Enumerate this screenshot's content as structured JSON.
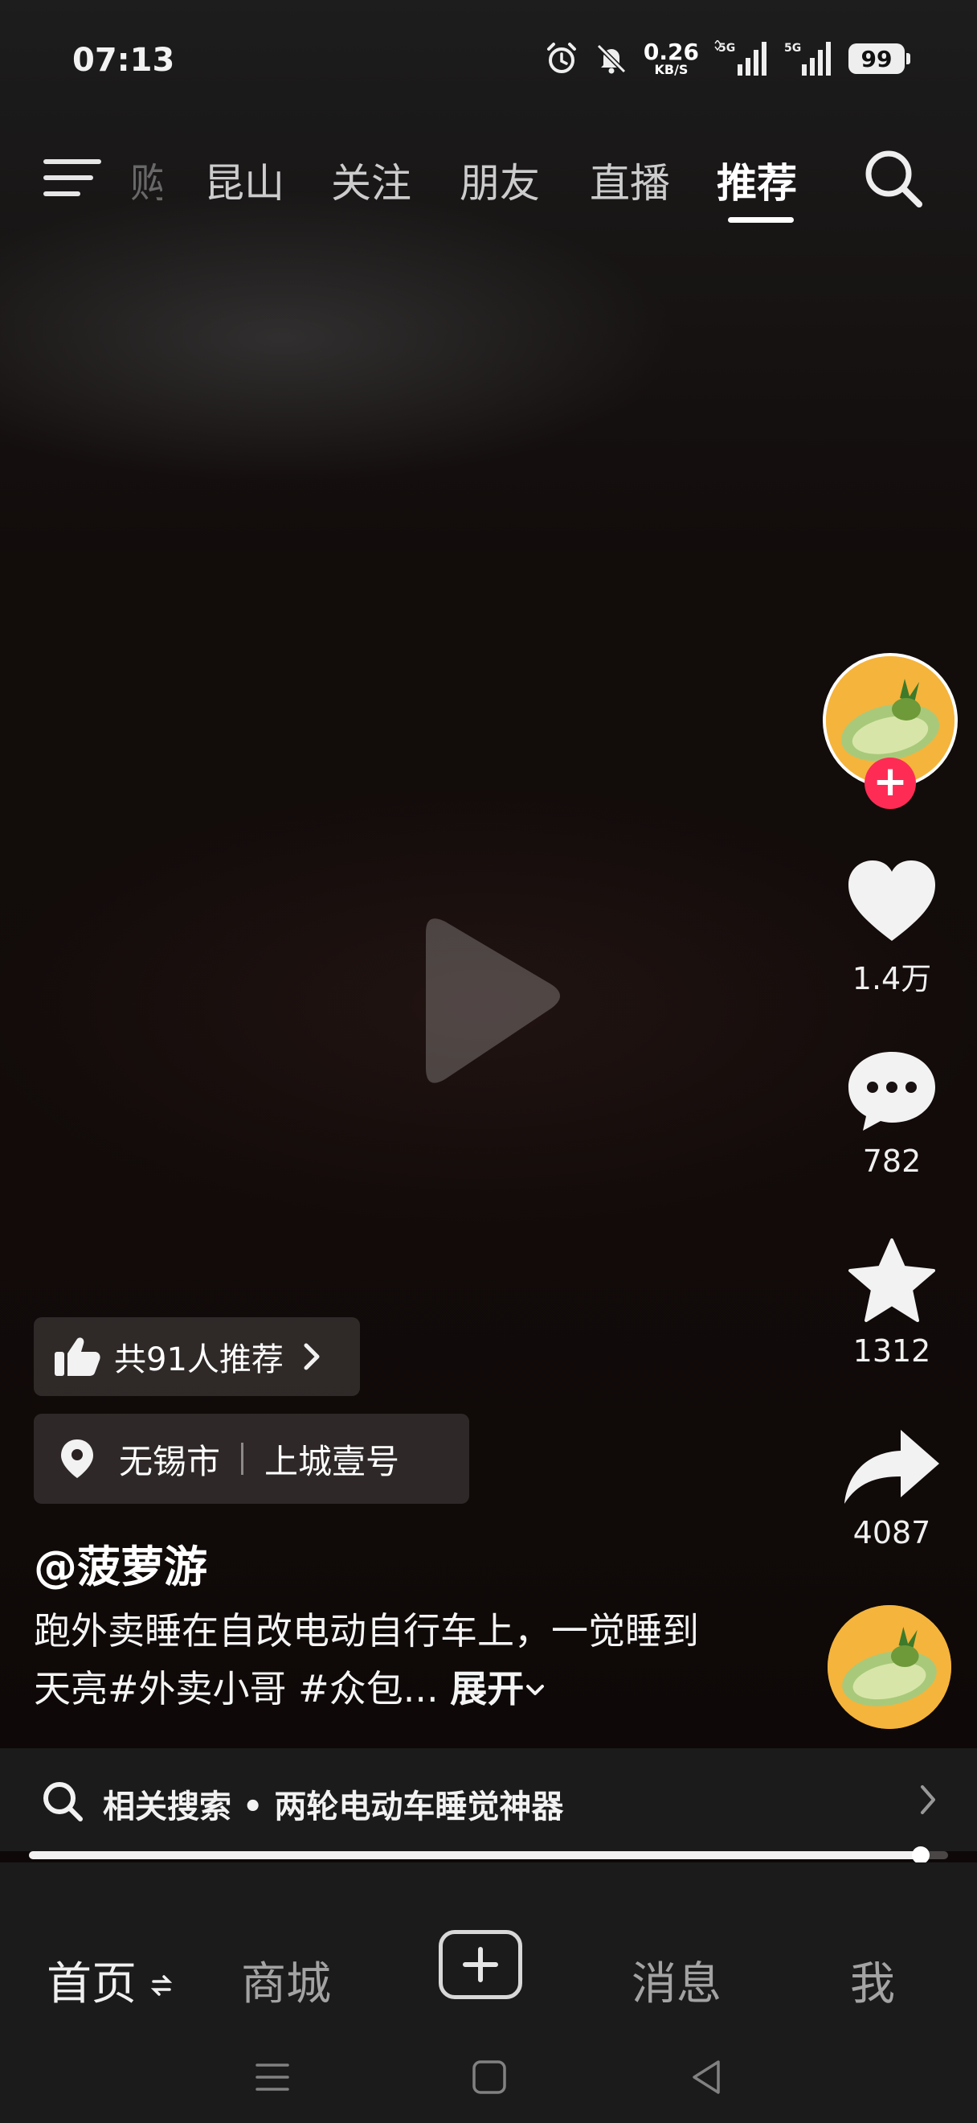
{
  "status_bar": {
    "time": "07:13",
    "net_speed_value": "0.26",
    "net_speed_unit": "KB/S",
    "network_1": "5G",
    "network_2": "5G",
    "battery": "99"
  },
  "top_nav": {
    "tabs": [
      {
        "label": "购"
      },
      {
        "label": "昆山"
      },
      {
        "label": "关注"
      },
      {
        "label": "朋友"
      },
      {
        "label": "直播"
      },
      {
        "label": "推荐"
      }
    ],
    "active_tab": "推荐"
  },
  "video": {
    "state": "paused",
    "recommend_label": "共91人推荐",
    "location_city": "无锡市",
    "location_place": "上城壹号",
    "author": "@菠萝游",
    "description": "跑外卖睡在自改电动自行车上，一觉睡到天亮#外卖小哥 #众包...",
    "expand_label": "展开",
    "progress": 0.97
  },
  "actions": {
    "likes": "1.4万",
    "comments": "782",
    "favorites": "1312",
    "shares": "4087"
  },
  "related_search": {
    "label": "相关搜索 • 两轮电动车睡觉神器"
  },
  "bottom_nav": {
    "items": [
      {
        "label": "首页"
      },
      {
        "label": "商城"
      },
      {
        "label": "消息"
      },
      {
        "label": "我"
      }
    ]
  },
  "colors": {
    "accent": "#fe2c55",
    "background": "#0b0707",
    "bottom_bar": "#1b1b1b"
  }
}
